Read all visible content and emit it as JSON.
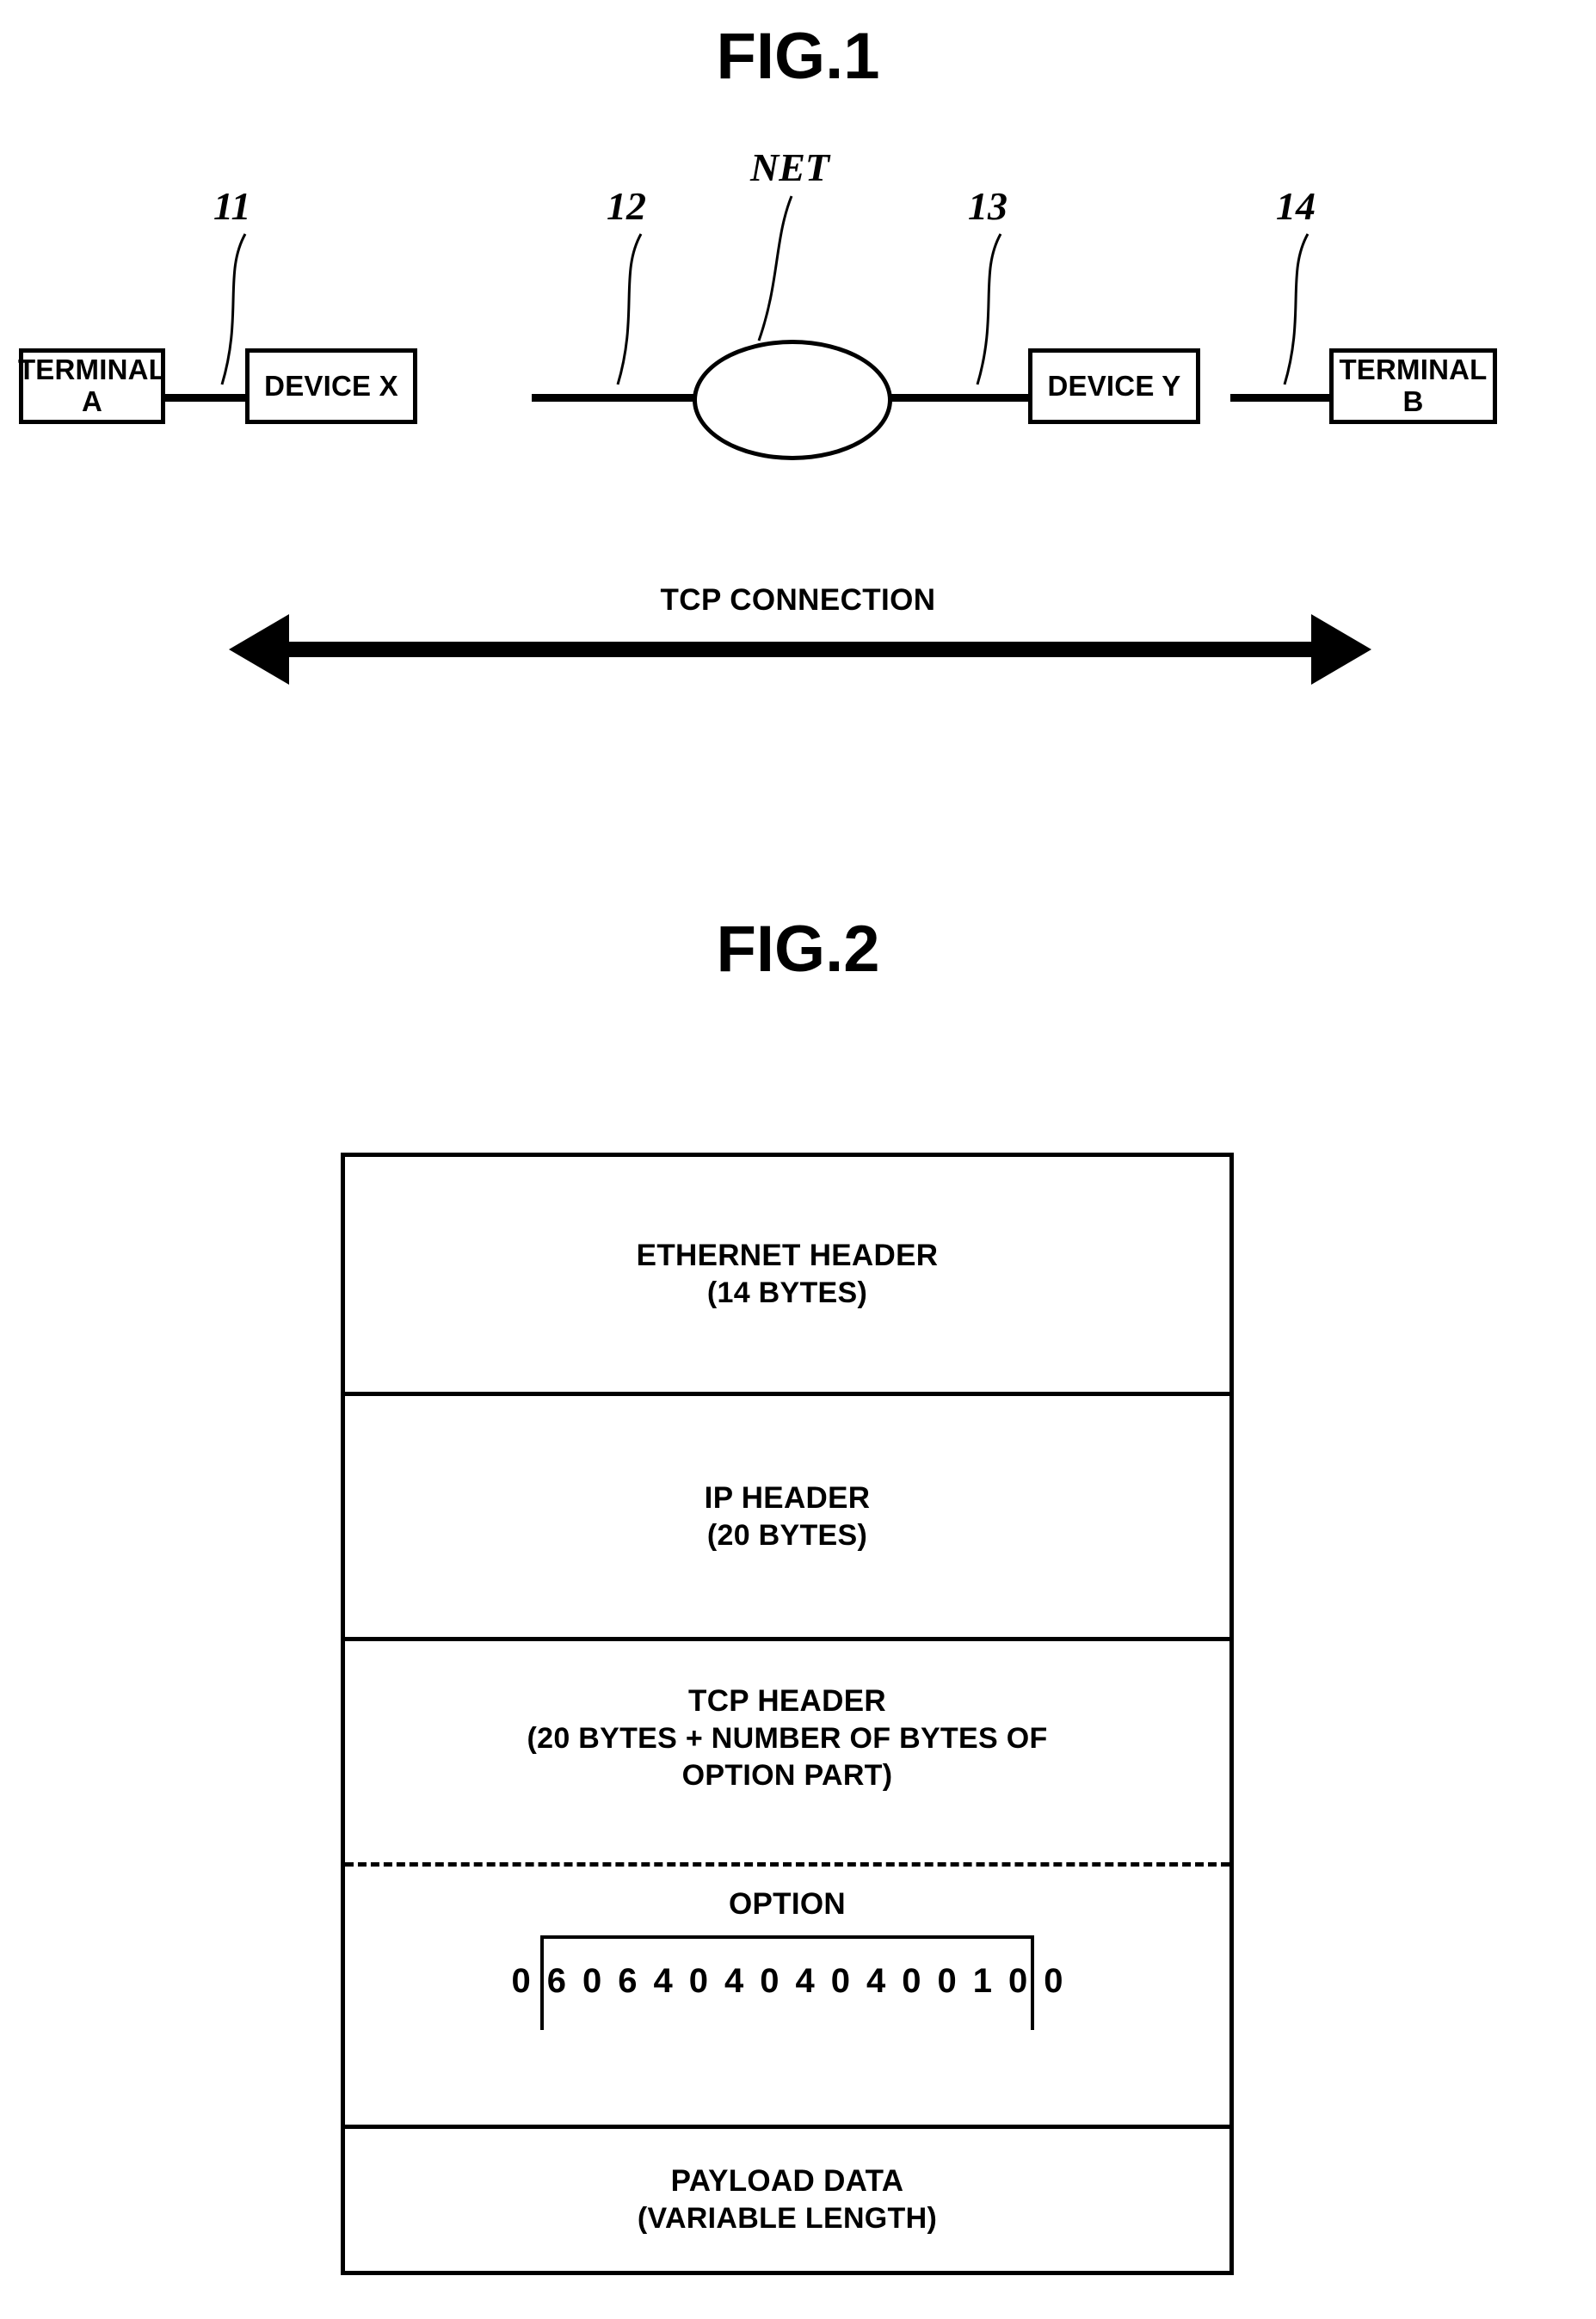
{
  "figure1": {
    "title": "FIG.1",
    "nodes": [
      {
        "id": "terminal-a",
        "line1": "TERMINAL",
        "line2": "A"
      },
      {
        "id": "device-x",
        "line1": "DEVICE X",
        "line2": ""
      },
      {
        "id": "device-y",
        "line1": "DEVICE Y",
        "line2": ""
      },
      {
        "id": "terminal-b",
        "line1": "TERMINAL",
        "line2": "B"
      }
    ],
    "network_label": "NET",
    "reference_numerals": [
      "11",
      "12",
      "13",
      "14"
    ],
    "connection_label": "TCP CONNECTION"
  },
  "figure2": {
    "title": "FIG.2",
    "packet_layers": [
      {
        "id": "ethernet-header",
        "name": "ETHERNET HEADER",
        "size": "(14 BYTES)"
      },
      {
        "id": "ip-header",
        "name": "IP HEADER",
        "size": "(20 BYTES)"
      },
      {
        "id": "tcp-header",
        "name": "TCP HEADER",
        "size": "(20 BYTES + NUMBER OF BYTES OF",
        "size2": "OPTION PART)"
      },
      {
        "id": "payload-data",
        "name": "PAYLOAD DATA",
        "size": "(VARIABLE LENGTH)"
      }
    ],
    "option": {
      "label": "OPTION",
      "bytes": [
        "0",
        "6",
        "0",
        "6",
        "4",
        "0",
        "4",
        "0",
        "4",
        "0",
        "4",
        "0",
        "0",
        "1",
        "0",
        "0"
      ]
    }
  }
}
